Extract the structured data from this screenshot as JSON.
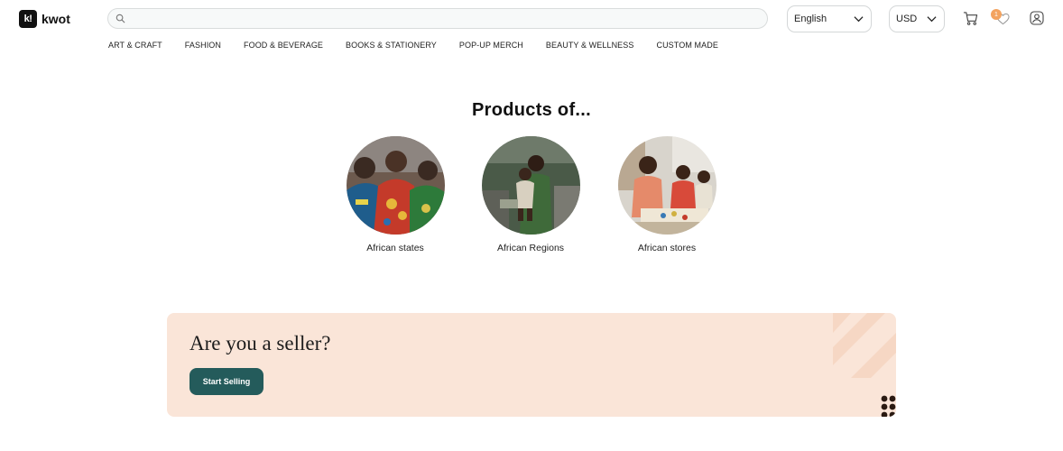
{
  "brand": {
    "logo_mark": "k!",
    "name": "kwot"
  },
  "search": {
    "placeholder": ""
  },
  "language": {
    "selected": "English"
  },
  "currency": {
    "selected": "USD"
  },
  "wishlist": {
    "badge_count": "1"
  },
  "nav": {
    "items": [
      "ART & CRAFT",
      "FASHION",
      "FOOD & BEVERAGE",
      "BOOKS & STATIONERY",
      "POP-UP MERCH",
      "BEAUTY & WELLNESS",
      "CUSTOM MADE"
    ]
  },
  "products": {
    "title": "Products of...",
    "categories": [
      {
        "label": "African states"
      },
      {
        "label": "African Regions"
      },
      {
        "label": "African stores"
      }
    ]
  },
  "seller_banner": {
    "title": "Are you a seller?",
    "button_label": "Start Selling"
  },
  "colors": {
    "accent": "#245b5b",
    "banner_bg": "#fae5d8",
    "badge": "#f3a35f"
  }
}
